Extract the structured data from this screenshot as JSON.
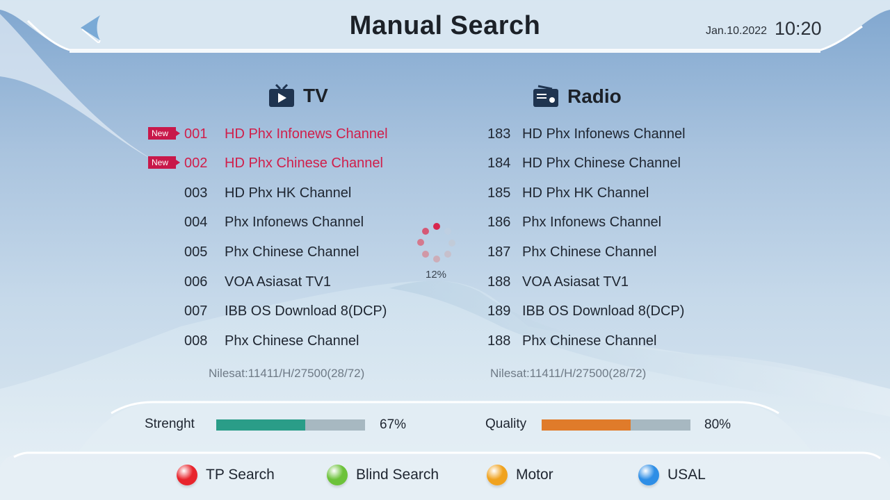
{
  "header": {
    "title": "Manual Search",
    "date": "Jan.10.2022",
    "time": "10:20"
  },
  "tv": {
    "label": "TV",
    "icon": "tv-icon",
    "channels": [
      {
        "num": "001",
        "name": "HD Phx Infonews Channel",
        "new": true
      },
      {
        "num": "002",
        "name": "HD Phx Chinese Channel",
        "new": true
      },
      {
        "num": "003",
        "name": "HD Phx HK Channel",
        "new": false
      },
      {
        "num": "004",
        "name": "Phx Infonews Channel",
        "new": false
      },
      {
        "num": "005",
        "name": "Phx Chinese Channel",
        "new": false
      },
      {
        "num": "006",
        "name": "VOA Asiasat TV1",
        "new": false
      },
      {
        "num": "007",
        "name": "IBB OS Download 8(DCP)",
        "new": false
      },
      {
        "num": "008",
        "name": "Phx Chinese Channel",
        "new": false
      }
    ],
    "tp_info": "Nilesat:11411/H/27500(28/72)"
  },
  "radio": {
    "label": "Radio",
    "icon": "radio-icon",
    "channels": [
      {
        "num": "183",
        "name": "HD Phx Infonews Channel"
      },
      {
        "num": "184",
        "name": "HD Phx Chinese Channel"
      },
      {
        "num": "185",
        "name": "HD Phx HK Channel"
      },
      {
        "num": "186",
        "name": "Phx Infonews Channel"
      },
      {
        "num": "187",
        "name": "Phx Chinese Channel"
      },
      {
        "num": "188",
        "name": "VOA Asiasat TV1"
      },
      {
        "num": "189",
        "name": "IBB OS Download 8(DCP)"
      },
      {
        "num": "188",
        "name": "Phx Chinese Channel"
      }
    ],
    "tp_info": "Nilesat:11411/H/27500(28/72)"
  },
  "badge_new": "New",
  "progress": {
    "percent_label": "12%",
    "fraction": 0.12
  },
  "signal": {
    "strength": {
      "label": "Strenght",
      "value_label": "67%",
      "fraction": 0.6,
      "color": "#2a9d88"
    },
    "quality": {
      "label": "Quality",
      "value_label": "80%",
      "fraction": 0.6,
      "color": "#e07b2a"
    }
  },
  "footer": {
    "buttons": [
      {
        "label": "TP Search",
        "color": "#e8242c",
        "icon": "red-key-icon"
      },
      {
        "label": "Blind Search",
        "color": "#6cc23a",
        "icon": "green-key-icon"
      },
      {
        "label": "Motor",
        "color": "#f0a21e",
        "icon": "yellow-key-icon"
      },
      {
        "label": "USAL",
        "color": "#2e8ee6",
        "icon": "blue-key-icon"
      }
    ]
  }
}
